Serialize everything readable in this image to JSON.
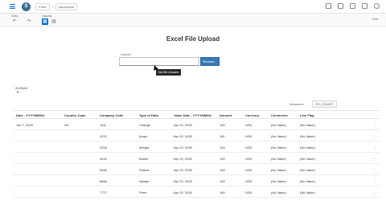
{
  "shell": {
    "crumbs": [
      "Folks",
      "sapsample"
    ]
  },
  "toolbar": {
    "group1": "Data",
    "group2": "Display",
    "edit": "Edit"
  },
  "upload": {
    "title": "Excel File Upload",
    "label": "Upload",
    "browse": "Browse...",
    "tooltip": "No file chosen"
  },
  "list": {
    "title": "XLSSAC",
    "sub": "▾"
  },
  "tabs": [
    {
      "label": "Measures"
    },
    {
      "label": "FC_COUNT"
    }
  ],
  "table": {
    "headers": [
      "Date - YYYYMMDD",
      "Country Code",
      "Company Code",
      "Type of Data",
      "Value Date - YYYYMMDD",
      "Amount",
      "Currency",
      "Comments",
      "Line Flag"
    ],
    "rows": [
      [
        "Jun 7, 2020",
        "US",
        "1111",
        "Change",
        "Apr 22, 2020",
        "100",
        "USD",
        "(No Value)",
        "(No Value)"
      ],
      [
        "",
        "",
        "2222",
        "Acqui",
        "Apr 22, 2020",
        "110",
        "USD",
        "(No Value)",
        "(No Value)"
      ],
      [
        "",
        "",
        "3333",
        "Merger",
        "Apr 22, 2020",
        "120",
        "USD",
        "(No Value)",
        "(No Value)"
      ],
      [
        "",
        "",
        "4444",
        "Buster",
        "Apr 22, 2020",
        "130",
        "USD",
        "(No Value)",
        "(No Value)"
      ],
      [
        "",
        "",
        "5555",
        "Shares",
        "Apr 22, 2020",
        "140",
        "USD",
        "(No Value)",
        "(No Value)"
      ],
      [
        "",
        "",
        "6666",
        "Swaps",
        "Apr 22, 2020",
        "150",
        "USD",
        "(No Value)",
        "(No Value)"
      ],
      [
        "",
        "",
        "7777",
        "Prem",
        "Apr 22, 2020",
        "160",
        "USD",
        "(No Value)",
        "(No Value)"
      ]
    ]
  }
}
